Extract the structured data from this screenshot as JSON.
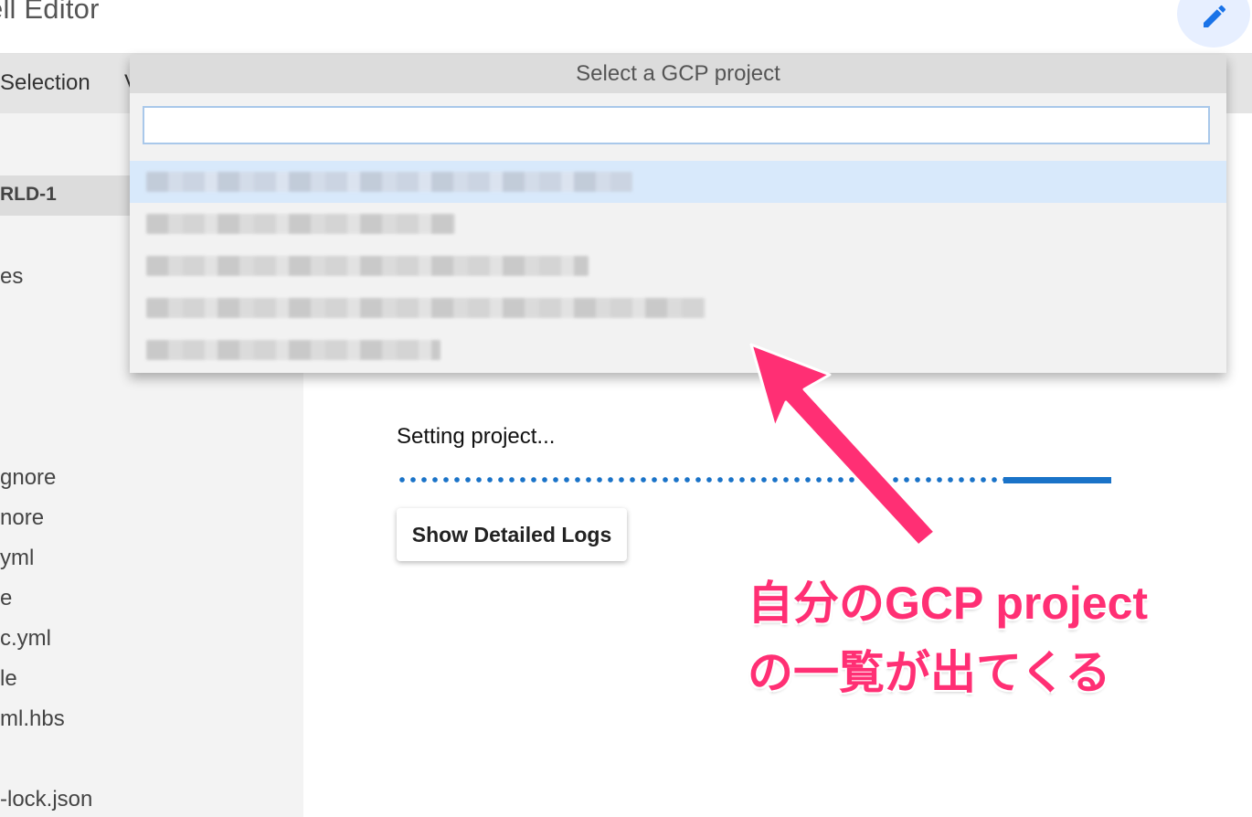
{
  "header": {
    "title": "ell Editor",
    "edit_icon": "pencil-icon"
  },
  "menubar": {
    "items": [
      "Selection",
      "V"
    ]
  },
  "sidebar": {
    "folder_label": "RLD-1",
    "files": [
      "es",
      "gnore",
      "nore",
      "yml",
      "e",
      "c.yml",
      "le",
      "ml.hbs",
      "-lock.json"
    ]
  },
  "dropdown": {
    "title": "Select a GCP project",
    "search_value": "",
    "search_placeholder": "",
    "project_count": 5,
    "selected_index": 0
  },
  "main": {
    "status_text": "Setting project...",
    "progress_fraction": 0.85,
    "logs_button_label": "Show Detailed Logs"
  },
  "annotation": {
    "line1": "自分のGCP project",
    "line2": "の一覧が出てくる",
    "color": "#ff2f74"
  },
  "colors": {
    "accent": "#1a73c8",
    "menubar": "#e4e4e4",
    "sidebar": "#f3f3f3",
    "selected_row": "#d8e9fb"
  }
}
